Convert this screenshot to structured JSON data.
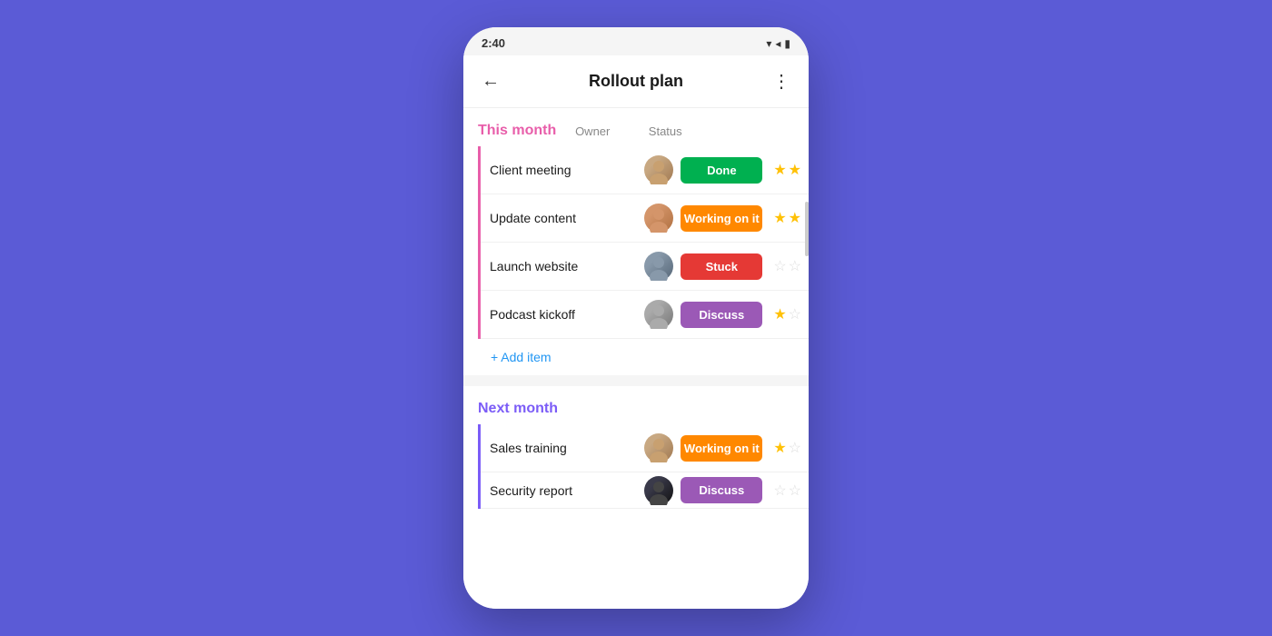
{
  "phone": {
    "status_bar": {
      "time": "2:40",
      "icons": "▼◀▉"
    },
    "header": {
      "back_label": "←",
      "title": "Rollout plan",
      "more_label": "⋮"
    },
    "sections": [
      {
        "id": "this-month",
        "title": "This month",
        "title_color": "#E85EAA",
        "border_color": "#E85EAA",
        "columns": [
          "Owner",
          "Status"
        ],
        "rows": [
          {
            "task": "Client meeting",
            "avatar_class": "avatar-1",
            "status": "Done",
            "badge_class": "badge-done",
            "stars": [
              true,
              true
            ]
          },
          {
            "task": "Update content",
            "avatar_class": "avatar-2",
            "status": "Working on it",
            "badge_class": "badge-working",
            "stars": [
              true,
              true
            ]
          },
          {
            "task": "Launch website",
            "avatar_class": "avatar-3",
            "status": "Stuck",
            "badge_class": "badge-stuck",
            "stars": [
              false,
              false
            ]
          },
          {
            "task": "Podcast kickoff",
            "avatar_class": "avatar-4",
            "status": "Discuss",
            "badge_class": "badge-discuss",
            "stars": [
              true,
              false
            ]
          }
        ],
        "add_label": "+ Add item"
      },
      {
        "id": "next-month",
        "title": "Next month",
        "title_color": "#7B5CF7",
        "border_color": "#7B5CF7",
        "columns": [],
        "rows": [
          {
            "task": "Sales training",
            "avatar_class": "avatar-5",
            "status": "Working on it",
            "badge_class": "badge-working",
            "stars": [
              true,
              false
            ]
          },
          {
            "task": "Security report",
            "avatar_class": "avatar-6",
            "status": "Discuss",
            "badge_class": "badge-discuss",
            "stars": [
              false,
              false
            ]
          }
        ],
        "add_label": ""
      }
    ]
  }
}
